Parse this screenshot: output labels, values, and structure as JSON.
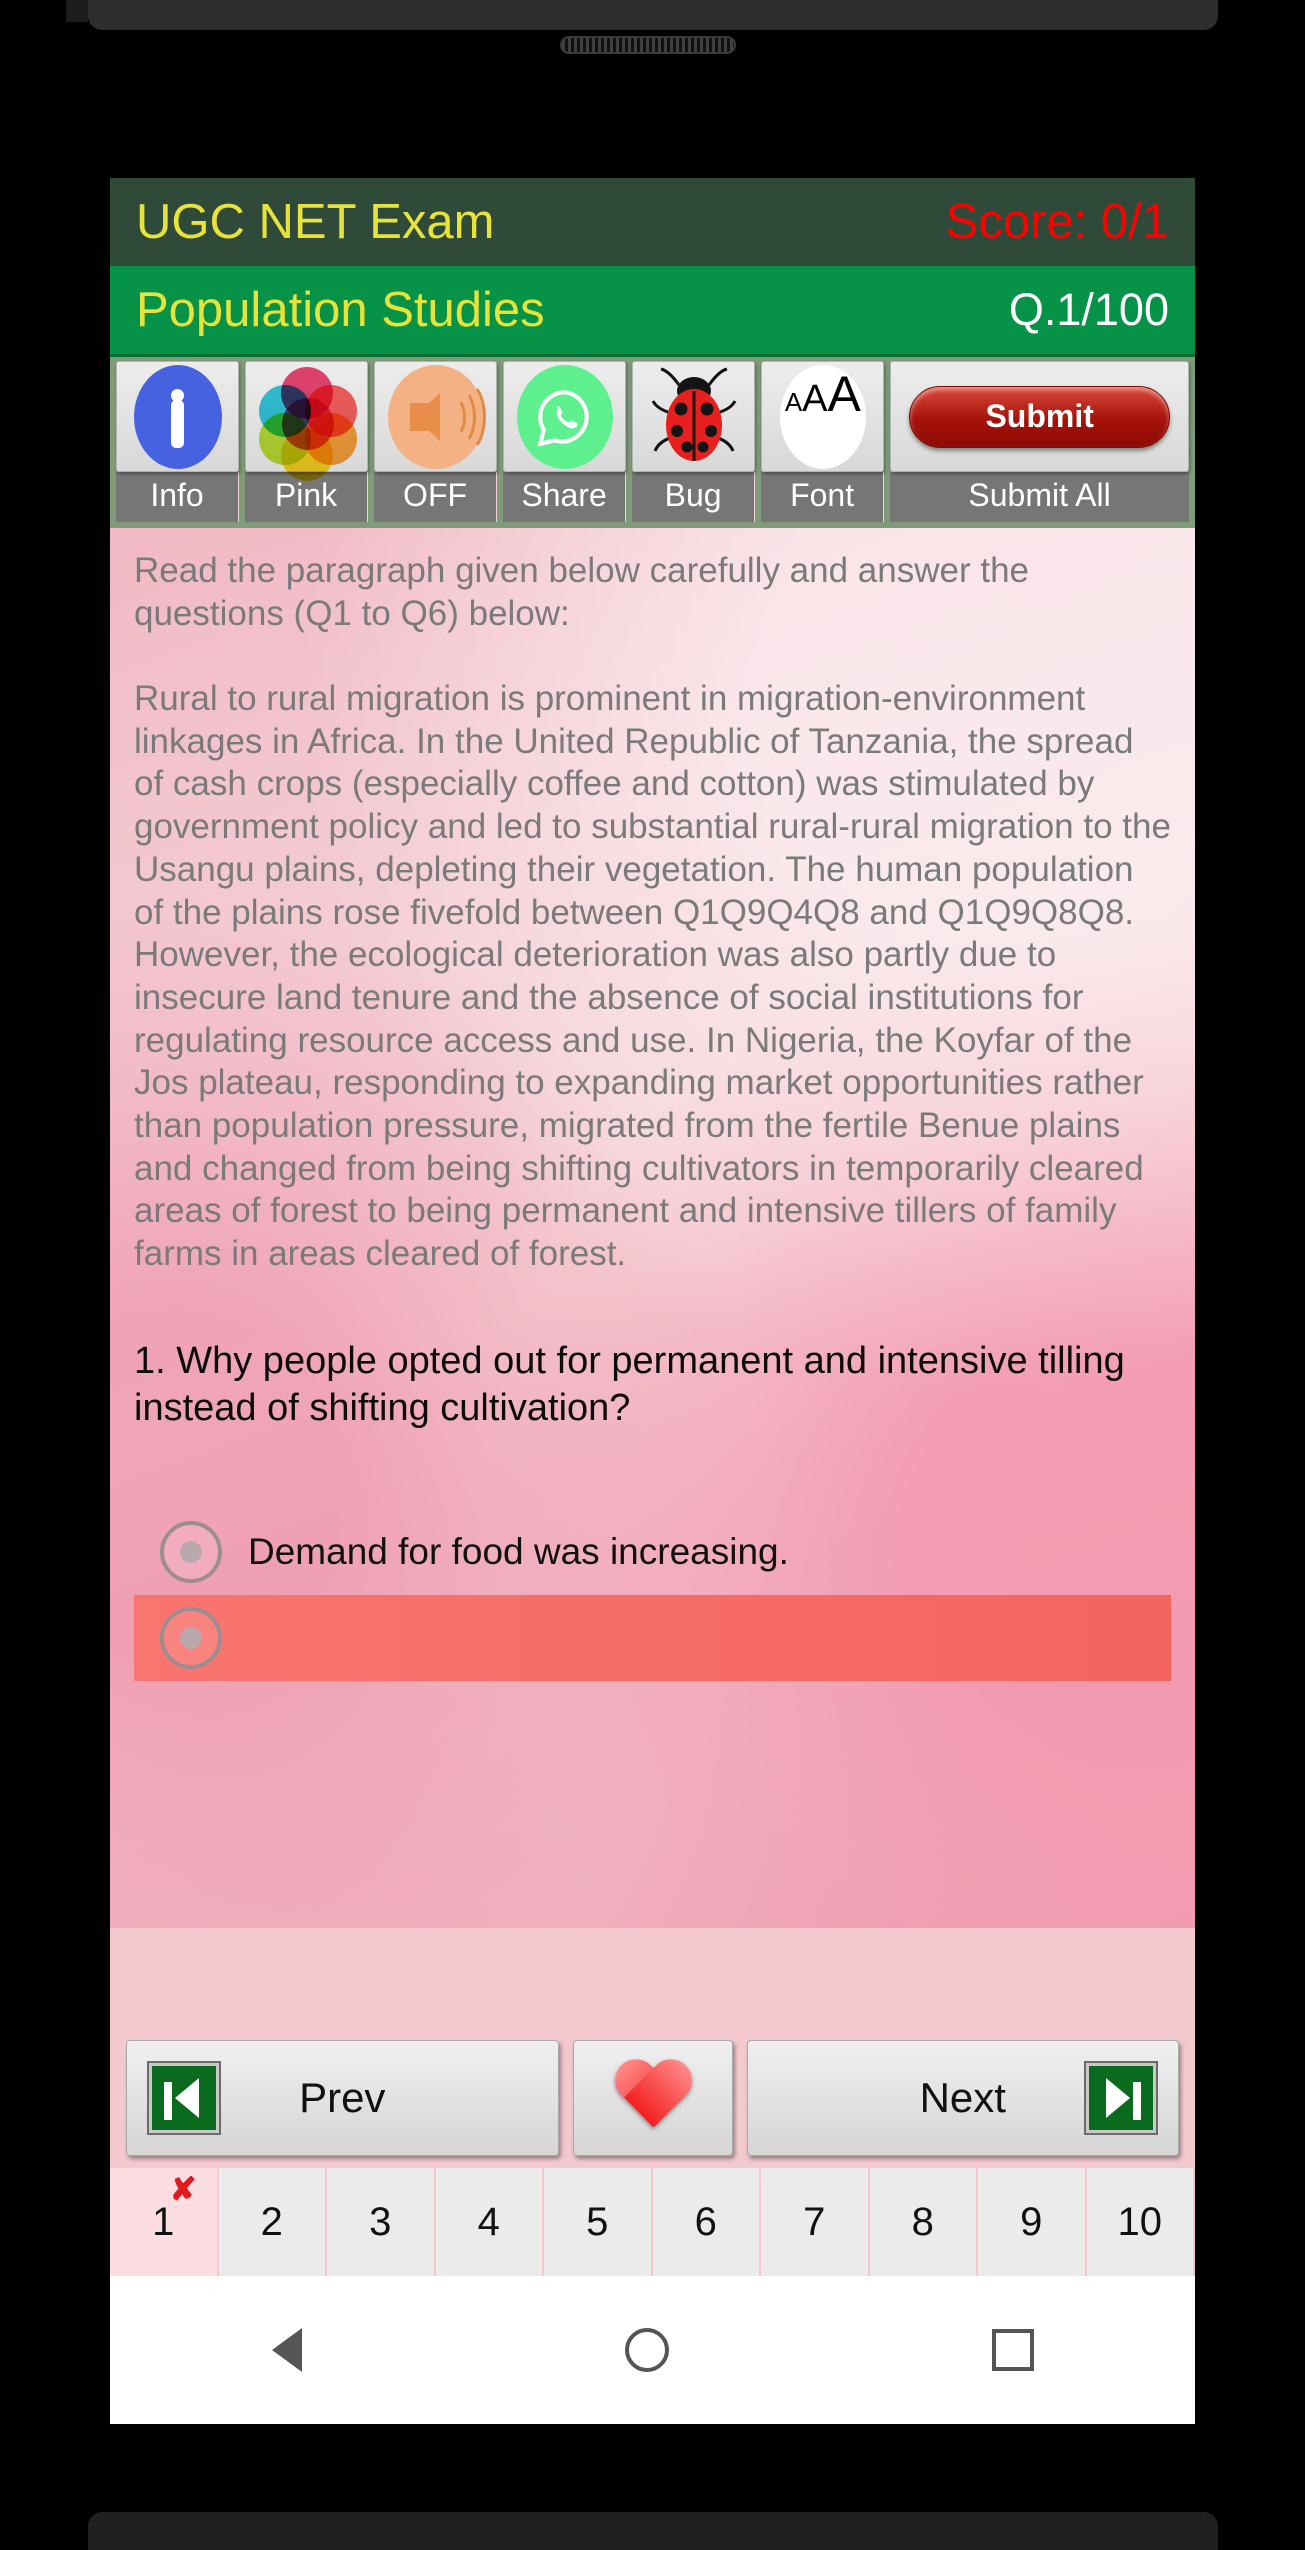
{
  "header": {
    "exam_title": "UGC NET Exam",
    "score_label": "Score: 0/1",
    "subject_title": "Population Studies",
    "question_counter": "Q.1/100",
    "header_bg": "#2f4a39",
    "subject_bg": "#069347",
    "title_color": "#e8e33a",
    "score_color": "#ff0000",
    "counter_color": "#ffffff"
  },
  "toolbar": {
    "items": [
      {
        "icon": "info-icon",
        "label": "Info"
      },
      {
        "icon": "color-palette-icon",
        "label": "Pink"
      },
      {
        "icon": "speaker-icon",
        "label": "OFF"
      },
      {
        "icon": "whatsapp-share-icon",
        "label": "Share"
      },
      {
        "icon": "ladybug-icon",
        "label": "Bug"
      },
      {
        "icon": "font-size-icon",
        "label": "Font"
      }
    ],
    "submit_button_label": "Submit",
    "submit_all_label": "Submit All",
    "submit_color": "#a51209",
    "font_icon_glyphs": {
      "small": "A",
      "medium": "A",
      "large": "A"
    }
  },
  "content": {
    "passage": "Read the paragraph given below carefully and answer the questions (Q1 to Q6) below:\n\nRural to rural migration is prominent in migration-environment linkages in Africa. In the United Republic of Tanzania, the spread of cash crops (especially coffee and cotton) was stimulated by government policy and led to substantial rural-rural migration to the Usangu plains, depleting their vegetation. The human population of the plains rose fivefold between Q1Q9Q4Q8 and Q1Q9Q8Q8. However, the ecological deterioration was also partly due to insecure land tenure and the absence of social institutions for regulating resource access and use. In Nigeria, the Koyfar of the Jos plateau, responding to expanding market opportunities rather than population pressure, migrated from the fertile Benue plains and changed from being shifting cultivators in temporarily cleared areas of forest to being permanent and intensive tillers of family farms in areas cleared of forest.",
    "question": "1. Why people opted out for permanent and intensive tilling instead of shifting cultivation?",
    "options": [
      {
        "label": "Demand for food was increasing.",
        "selected": false,
        "highlighted": false
      },
      {
        "label": "",
        "selected": false,
        "highlighted": true
      }
    ]
  },
  "navigation": {
    "prev_label": "Prev",
    "next_label": "Next",
    "favorite_icon": "heart-icon",
    "prev_icon": "skip-previous-icon",
    "next_icon": "skip-next-icon"
  },
  "question_numbers": {
    "cells": [
      "1",
      "2",
      "3",
      "4",
      "5",
      "6",
      "7",
      "8",
      "9",
      "10"
    ],
    "current": "1",
    "incorrect_mark": "✘"
  },
  "system_nav": {
    "back": "back-triangle-icon",
    "home": "home-circle-icon",
    "recents": "recents-square-icon"
  }
}
